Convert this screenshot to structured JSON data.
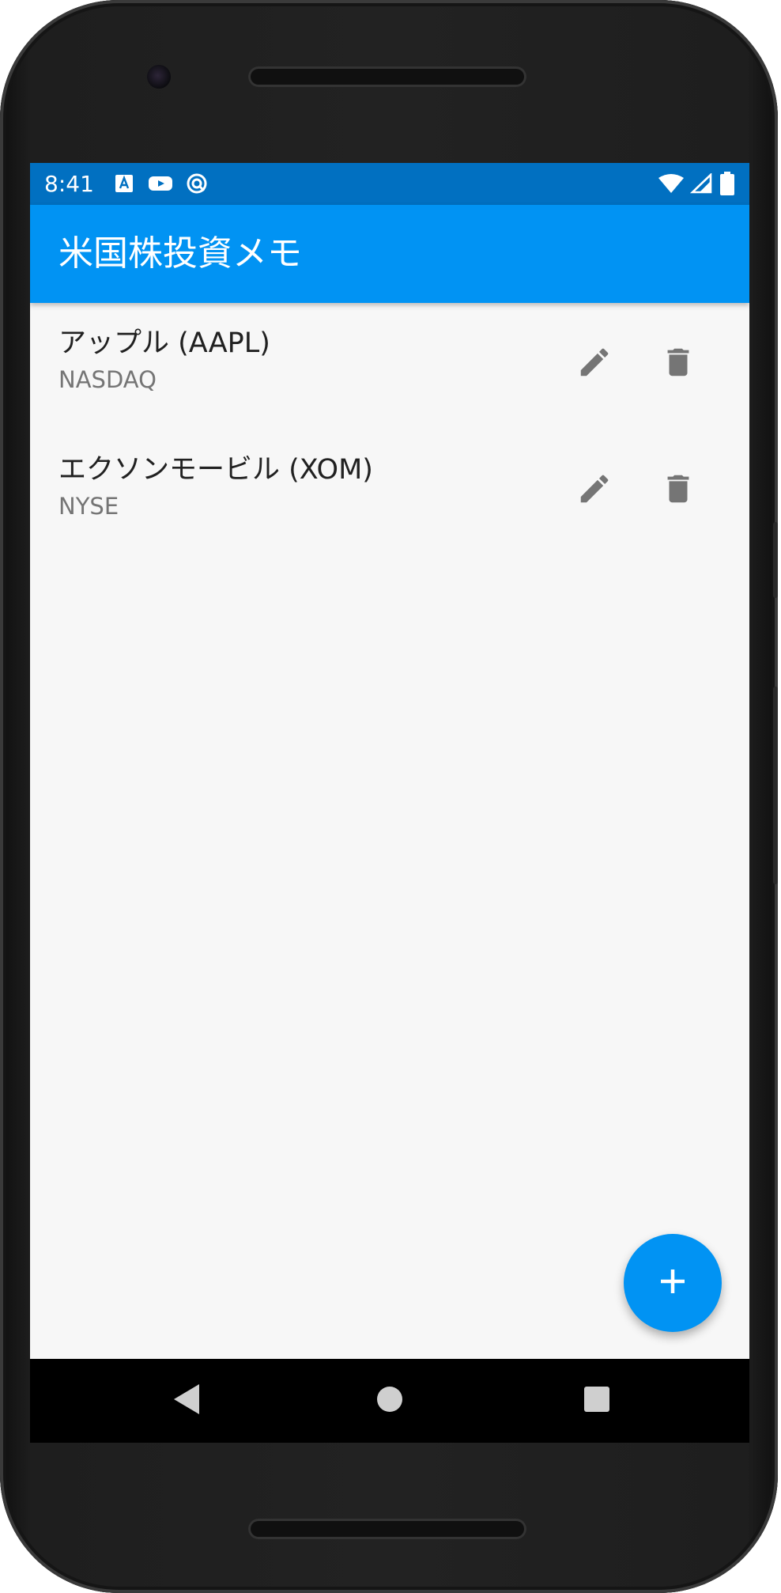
{
  "status_bar": {
    "time": "8:41",
    "notification_icons": [
      "font-icon",
      "youtube-icon",
      "sync-icon"
    ],
    "system_icons": [
      "wifi-icon",
      "signal-icon",
      "battery-icon"
    ]
  },
  "app_bar": {
    "title": "米国株投資メモ"
  },
  "stocks": [
    {
      "title": "アップル (AAPL)",
      "exchange": "NASDAQ"
    },
    {
      "title": "エクソンモービル (XOM)",
      "exchange": "NYSE"
    }
  ],
  "icons": {
    "edit": "pencil-icon",
    "delete": "trash-icon",
    "add": "plus-icon"
  },
  "nav_bar": {
    "buttons": [
      "back-icon",
      "home-icon",
      "recents-icon"
    ]
  },
  "colors": {
    "status_bar": "#0170c1",
    "app_bar": "#0193f3",
    "accent": "#0193f3",
    "background": "#f7f7f7",
    "icon_grey": "#757575"
  }
}
